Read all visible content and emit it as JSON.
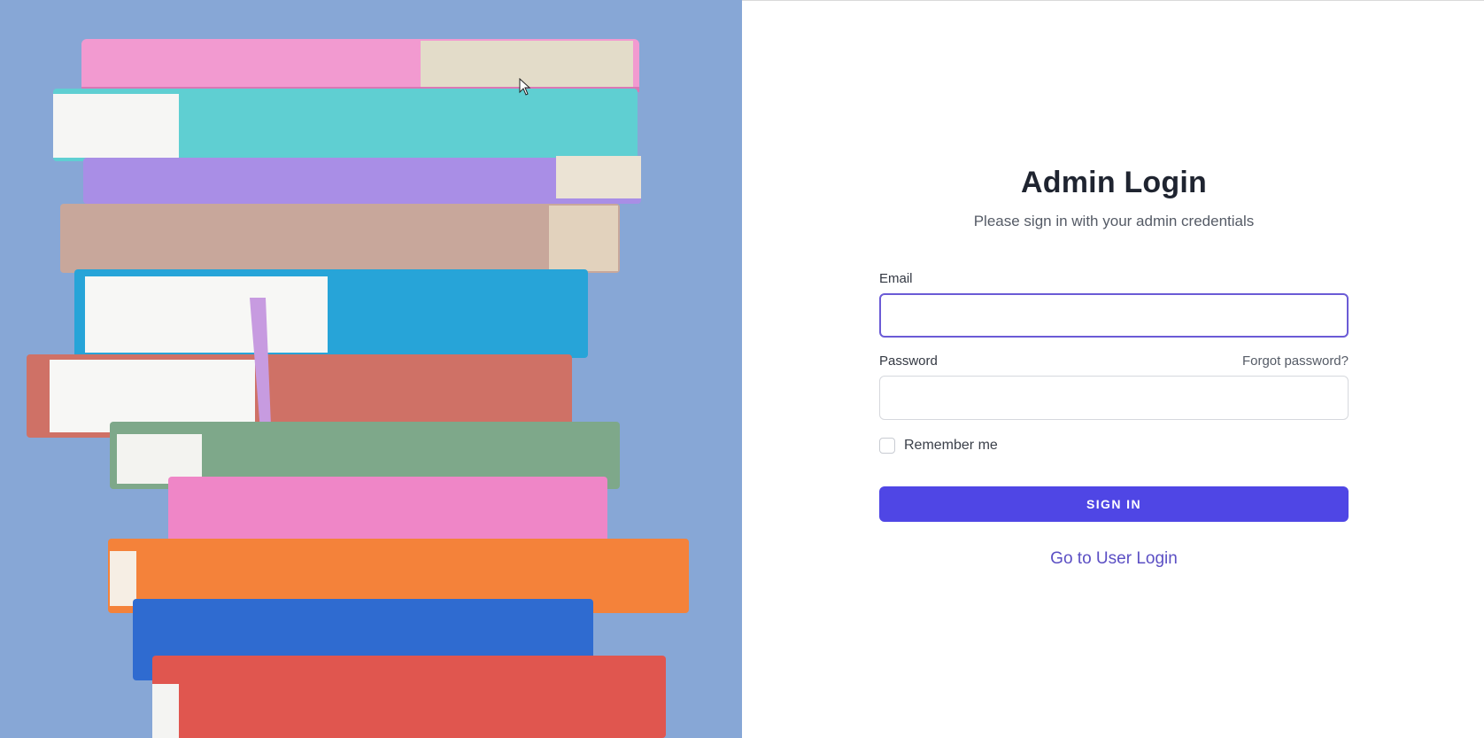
{
  "login": {
    "title": "Admin Login",
    "subtitle": "Please sign in with your admin credentials",
    "email_label": "Email",
    "email_value": "",
    "password_label": "Password",
    "password_value": "",
    "forgot_link": "Forgot password?",
    "remember_label": "Remember me",
    "remember_checked": false,
    "signin_label": "SIGN IN",
    "user_login_link": "Go to User Login"
  },
  "hero": {
    "image": "stacked-colorful-books",
    "background": "#87a7d6"
  },
  "colors": {
    "accent": "#4f46e5",
    "focus_border": "#6b5bd6",
    "link": "#5b4fc4"
  }
}
